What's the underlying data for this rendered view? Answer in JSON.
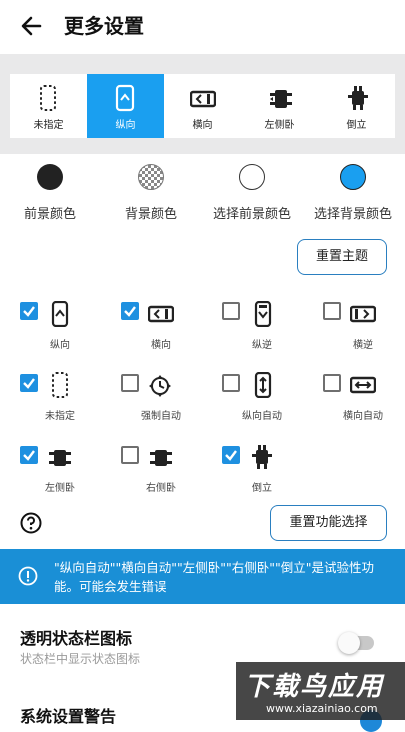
{
  "header": {
    "title": "更多设置"
  },
  "orientation": {
    "options": [
      {
        "label": "未指定",
        "icon": "unspecified-icon"
      },
      {
        "label": "纵向",
        "icon": "portrait-icon",
        "selected": true
      },
      {
        "label": "横向",
        "icon": "landscape-icon"
      },
      {
        "label": "左侧卧",
        "icon": "lie-left-icon"
      },
      {
        "label": "倒立",
        "icon": "upside-down-icon"
      }
    ]
  },
  "colors": {
    "items": [
      {
        "label": "前景颜色",
        "color": "#222222"
      },
      {
        "label": "背景颜色",
        "color": "checker"
      },
      {
        "label": "选择前景颜色",
        "color": "#ffffff"
      },
      {
        "label": "选择背景颜色",
        "color": "#1a9ff0"
      }
    ],
    "reset_theme": "重置主题"
  },
  "functions": {
    "items": [
      {
        "label": "纵向",
        "checked": true
      },
      {
        "label": "横向",
        "checked": true
      },
      {
        "label": "纵逆",
        "checked": false
      },
      {
        "label": "横逆",
        "checked": false
      },
      {
        "label": "未指定",
        "checked": true
      },
      {
        "label": "强制自动",
        "checked": false
      },
      {
        "label": "纵向自动",
        "checked": false
      },
      {
        "label": "横向自动",
        "checked": false
      },
      {
        "label": "左侧卧",
        "checked": true
      },
      {
        "label": "右侧卧",
        "checked": false
      },
      {
        "label": "倒立",
        "checked": true
      }
    ],
    "reset_label": "重置功能选择"
  },
  "banner": {
    "text": "\"纵向自动\"\"横向自动\"\"左侧卧\"\"右侧卧\"\"倒立\"是试验性功能。可能会发生错误"
  },
  "settings": {
    "status_icon": {
      "title": "透明状态栏图标",
      "desc": "状态栏中显示状态图标",
      "enabled": false
    },
    "system_warning": {
      "title": "系统设置警告"
    }
  },
  "watermark": {
    "line1": "下载鸟应用",
    "line2": "www.xiazainiao.com"
  },
  "accent": "#1a9ff0"
}
